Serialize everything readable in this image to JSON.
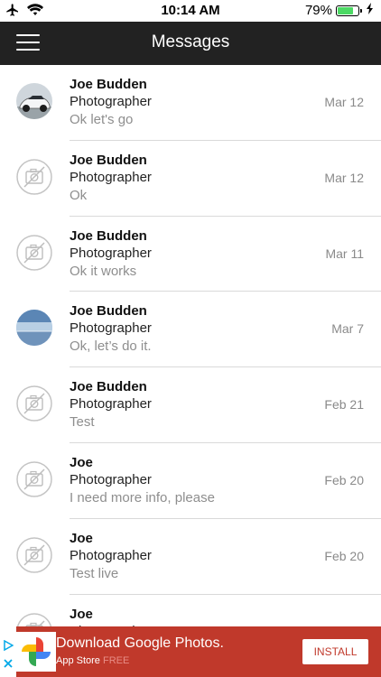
{
  "status_bar": {
    "time": "10:14 AM",
    "battery_percent": "79%",
    "battery_level": 0.79,
    "icons": [
      "airplane-icon",
      "wifi-icon",
      "battery-icon",
      "charging-bolt-icon"
    ]
  },
  "nav": {
    "title": "Messages",
    "menu_icon": "hamburger-menu-icon"
  },
  "messages": [
    {
      "name": "Joe Budden",
      "role": "Photographer",
      "preview": "Ok let's go",
      "date": "Mar 12",
      "avatar": "car-photo"
    },
    {
      "name": "Joe Budden",
      "role": "Photographer",
      "preview": "Ok",
      "date": "Mar 12",
      "avatar": "no-photo-icon"
    },
    {
      "name": "Joe Budden",
      "role": "Photographer",
      "preview": "Ok it works",
      "date": "Mar 11",
      "avatar": "no-photo-icon"
    },
    {
      "name": "Joe Budden",
      "role": "Photographer",
      "preview": "Ok, let’s do it.",
      "date": "Mar 7",
      "avatar": "landscape-photo"
    },
    {
      "name": "Joe Budden",
      "role": "Photographer",
      "preview": "Test",
      "date": "Feb 21",
      "avatar": "no-photo-icon"
    },
    {
      "name": "Joe",
      "role": "Photographer",
      "preview": "I need more info, please",
      "date": "Feb 20",
      "avatar": "no-photo-icon"
    },
    {
      "name": "Joe",
      "role": "Photographer",
      "preview": "Test live",
      "date": "Feb 20",
      "avatar": "no-photo-icon"
    },
    {
      "name": "Joe",
      "role": "Photographer",
      "preview": "",
      "date": "",
      "avatar": "no-photo-icon"
    }
  ],
  "ad": {
    "title": "Download Google Photos.",
    "store": "App Store",
    "price": "FREE",
    "button": "INSTALL",
    "icons": [
      "adchoices-icon",
      "close-ad-icon",
      "google-photos-logo"
    ],
    "accent_color": "#c0392b"
  }
}
